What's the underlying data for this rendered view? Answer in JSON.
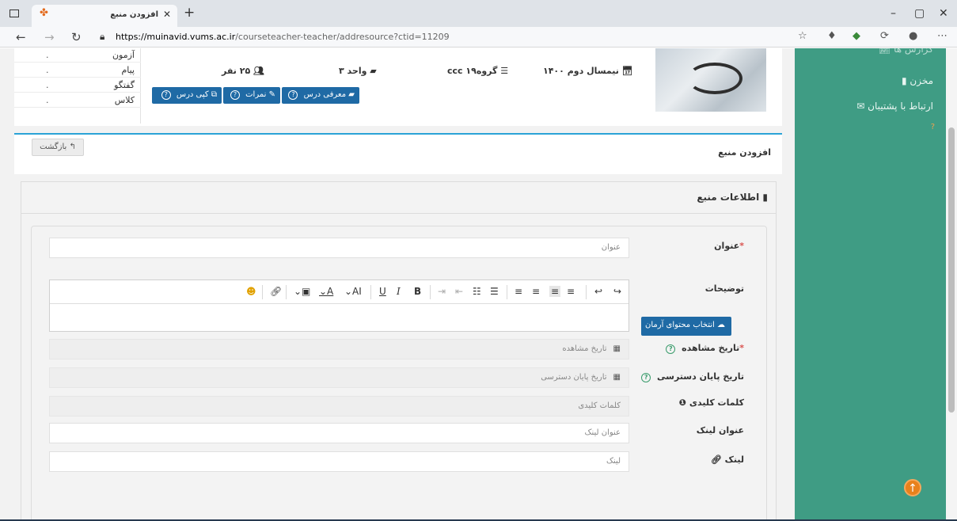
{
  "browser": {
    "tab_title": "افزودن منبع",
    "url_host": "https://muinavid.vums.ac.ir",
    "url_path": "/courseteacher-teacher/addresource?ctid=11209"
  },
  "course_menu": [
    {
      "label": "آزمون",
      "dot": "."
    },
    {
      "label": "پیام",
      "dot": "."
    },
    {
      "label": "گفتگو",
      "dot": "."
    },
    {
      "label": "کلاس",
      "dot": "."
    }
  ],
  "course": {
    "semester": "نیمسال دوم ۱۴۰۰",
    "group": "گروه۱۹ ccc",
    "units": "واحد ۳",
    "students": "۲۵ نفر",
    "buttons": {
      "intro": "معرفی درس",
      "grades": "نمرات",
      "copy": "کپی درس"
    }
  },
  "sidebar": {
    "items": [
      "گزارش ها",
      "مخزن",
      "ارتباط با پشتیبان"
    ]
  },
  "page": {
    "title": "افزودن منبع",
    "back": "بازگشت"
  },
  "panel": {
    "title": "اطلاعات منبع"
  },
  "form": {
    "title_label": "عنوان",
    "title_placeholder": "عنوان",
    "desc_label": "توضیحات",
    "view_date_label": "تاریخ مشاهده",
    "view_date_placeholder": "تاریخ مشاهده",
    "end_date_label": "تاریخ پایان دسترسی",
    "end_date_placeholder": "تاریخ پایان دسترسی",
    "keywords_label": "کلمات کلیدی",
    "keywords_placeholder": "کلمات کلیدی",
    "link_title_label": "عنوان لینک",
    "link_title_placeholder": "عنوان لینک",
    "link_label": "لینک",
    "link_placeholder": "لینک",
    "select_content_button": "انتخاب محتوای آرمان"
  },
  "icons": {
    "accent": "#1f6aa5",
    "sidebar_bg": "#3f9c84",
    "scroll_top": "#e8811c"
  }
}
